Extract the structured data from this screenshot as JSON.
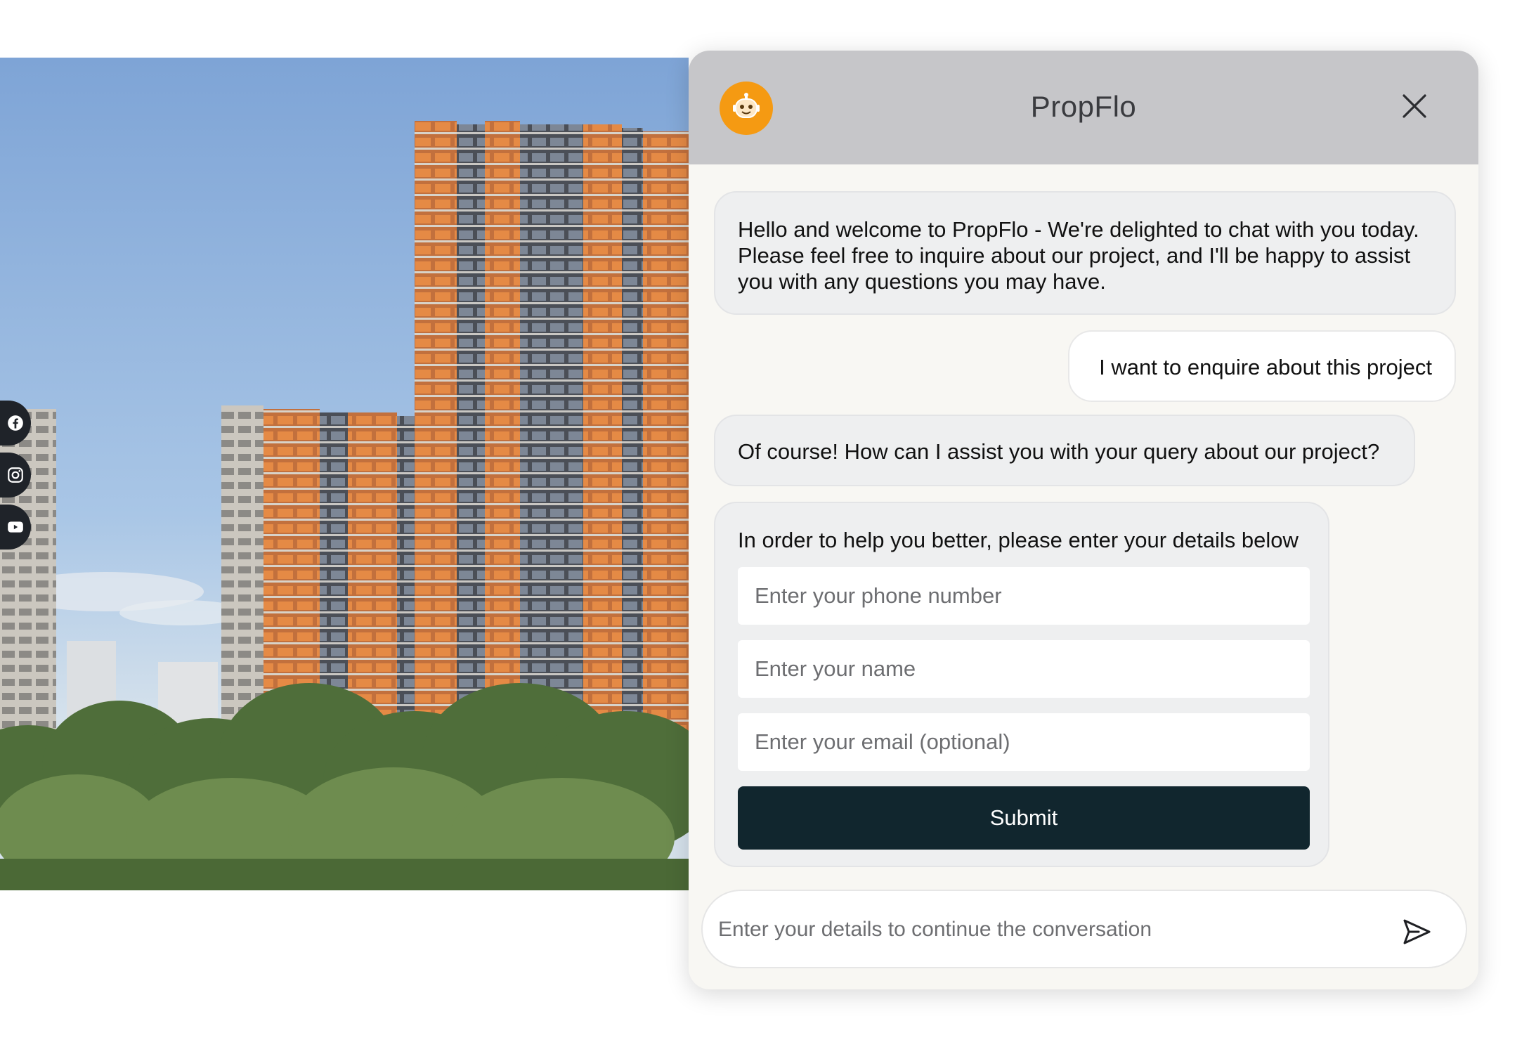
{
  "widget": {
    "title": "PropFlo",
    "colors": {
      "header": "#c6c6c9",
      "avatar": "#f59a12",
      "submit": "#11262e",
      "panel": "#f8f7f3"
    }
  },
  "messages": [
    {
      "from": "bot",
      "text": "Hello and welcome to PropFlo - We're delighted to chat with you today. Please feel free to inquire about our project, and I'll be happy to assist you with any questions you may have."
    },
    {
      "from": "user",
      "text": "I want to enquire about this project"
    },
    {
      "from": "bot",
      "text": "Of course! How can I assist you with your query about our project?"
    }
  ],
  "lead_form": {
    "intro": "In order to help you better, please enter your details below",
    "phone_placeholder": "Enter your phone number",
    "name_placeholder": "Enter your name",
    "email_placeholder": "Enter your email (optional)",
    "submit_label": "Submit"
  },
  "composer": {
    "placeholder": "Enter your details to continue the conversation"
  },
  "social": [
    {
      "icon": "facebook-icon"
    },
    {
      "icon": "instagram-icon"
    },
    {
      "icon": "youtube-icon"
    }
  ]
}
